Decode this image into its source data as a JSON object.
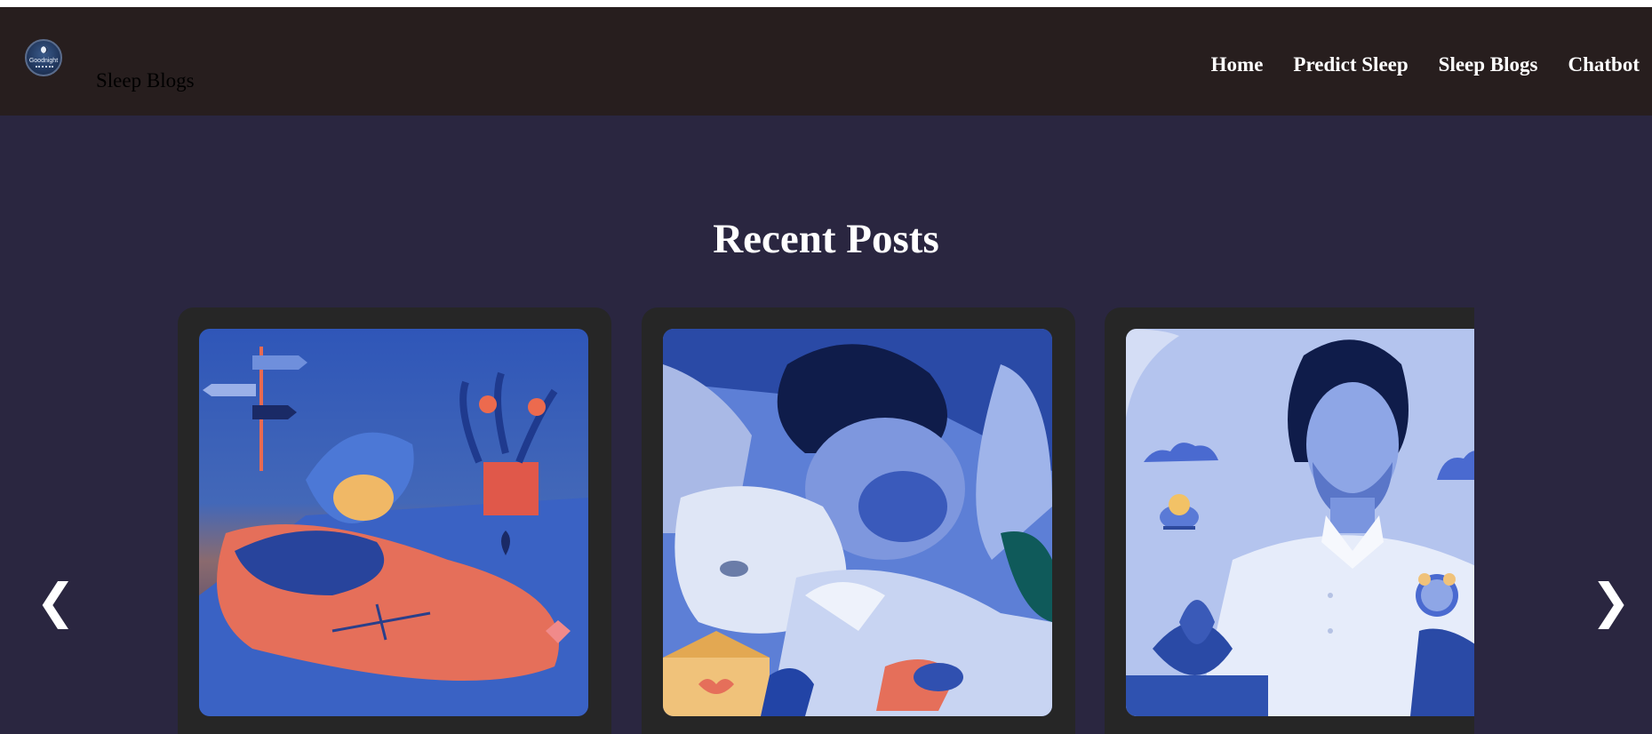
{
  "navbar": {
    "brand": "Sleep Blogs",
    "logo_text": "Goodnight",
    "items": [
      {
        "label": "Home"
      },
      {
        "label": "Predict Sleep"
      },
      {
        "label": "Sleep Blogs"
      },
      {
        "label": "Chatbot"
      }
    ]
  },
  "main": {
    "section_title": "Recent Posts",
    "carousel": {
      "prev_label": "❮",
      "next_label": "❯",
      "cards": [
        {
          "image": "illustration-person-sleeping-in-bed-with-plants"
        },
        {
          "image": "man-sleeping-with-dog"
        },
        {
          "image": "man-meditating-with-eyes-closed"
        }
      ]
    }
  },
  "colors": {
    "navbar_bg": "#271e1e",
    "content_bg": "#2a2640",
    "card_bg": "#262626",
    "accent_blue": "#3b5fc4"
  }
}
